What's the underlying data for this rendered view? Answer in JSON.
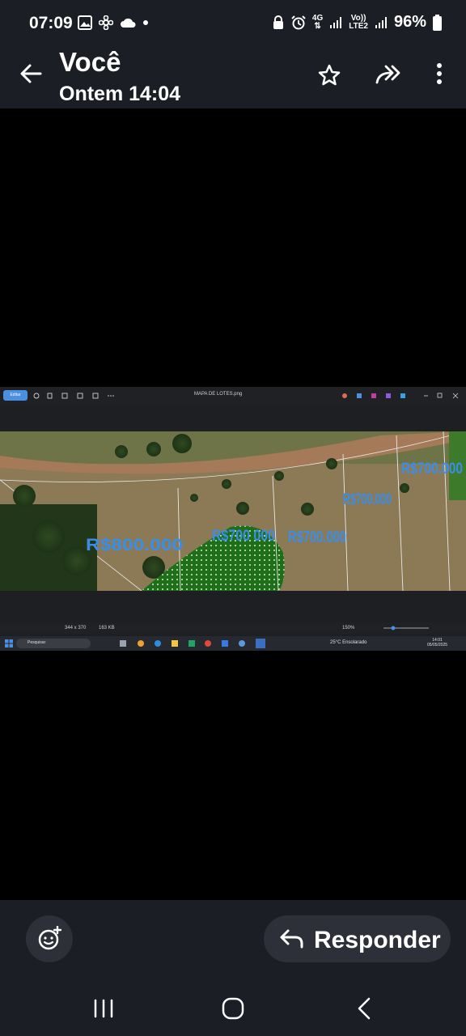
{
  "status_bar": {
    "time": "07:09",
    "network_top": "4G",
    "volte_label": "Vo))",
    "lte_label": "LTE2",
    "battery": "96%"
  },
  "app_bar": {
    "title": "Você",
    "subtitle": "Ontem 14:04"
  },
  "media": {
    "viewer_tool_label": "Editar",
    "file_name": "MAPA DE LOTES.png",
    "status_dims": "344 x 370",
    "status_size": "163 KB",
    "zoom": "150%",
    "taskbar_search": "Pesquisar",
    "weather": "25°C Ensolarado",
    "clock_time": "14:01",
    "clock_date": "05/05/2025",
    "map_labels": {
      "lot_left": "R$800.000",
      "lot_green": "R$700 000",
      "lot_mid": "R$700.000",
      "lot_right_a": "R$700.000",
      "lot_right_b": "R$700.000"
    }
  },
  "actions": {
    "reply_label": "Responder"
  }
}
